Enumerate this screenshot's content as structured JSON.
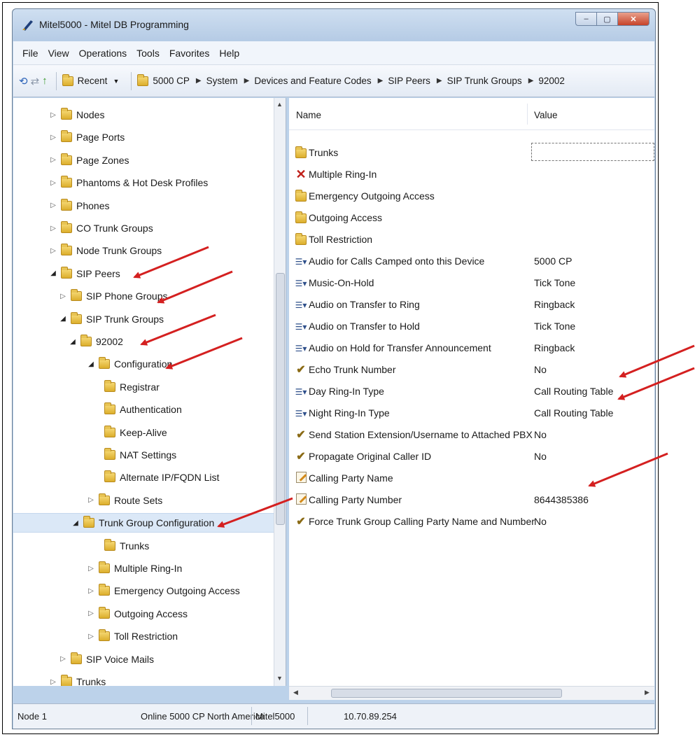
{
  "window": {
    "title": "Mitel5000 - Mitel DB Programming",
    "controls": {
      "minimize": "–",
      "maximize": "▢",
      "close": "✕"
    }
  },
  "menubar": [
    "File",
    "View",
    "Operations",
    "Tools",
    "Favorites",
    "Help"
  ],
  "navbar": {
    "recent_label": "Recent",
    "breadcrumbs": [
      "5000 CP",
      "System",
      "Devices and Feature Codes",
      "SIP Peers",
      "SIP Trunk Groups",
      "92002"
    ]
  },
  "tree": {
    "items": [
      {
        "label": "Nodes",
        "state": "collapsed"
      },
      {
        "label": "Page Ports",
        "state": "collapsed"
      },
      {
        "label": "Page Zones",
        "state": "collapsed"
      },
      {
        "label": "Phantoms & Hot Desk Profiles",
        "state": "collapsed"
      },
      {
        "label": "Phones",
        "state": "collapsed"
      },
      {
        "label": "CO Trunk Groups",
        "state": "collapsed"
      },
      {
        "label": "Node Trunk Groups",
        "state": "collapsed"
      },
      {
        "label": "SIP Peers",
        "state": "expanded"
      },
      {
        "label": "SIP Phone Groups",
        "state": "collapsed"
      },
      {
        "label": "SIP Trunk Groups",
        "state": "expanded"
      },
      {
        "label": "92002",
        "state": "expanded"
      },
      {
        "label": "Configuration",
        "state": "expanded"
      },
      {
        "label": "Registrar",
        "state": "leaf"
      },
      {
        "label": "Authentication",
        "state": "leaf"
      },
      {
        "label": "Keep-Alive",
        "state": "leaf"
      },
      {
        "label": "NAT Settings",
        "state": "leaf"
      },
      {
        "label": "Alternate IP/FQDN List",
        "state": "leaf"
      },
      {
        "label": "Route Sets",
        "state": "collapsed"
      },
      {
        "label": "Trunk Group Configuration",
        "state": "expanded",
        "selected": true
      },
      {
        "label": "Trunks",
        "state": "leaf"
      },
      {
        "label": "Multiple Ring-In",
        "state": "collapsed"
      },
      {
        "label": "Emergency Outgoing Access",
        "state": "collapsed"
      },
      {
        "label": "Outgoing Access",
        "state": "collapsed"
      },
      {
        "label": "Toll Restriction",
        "state": "collapsed"
      },
      {
        "label": "SIP Voice Mails",
        "state": "collapsed"
      },
      {
        "label": "Trunks",
        "state": "collapsed"
      }
    ]
  },
  "list": {
    "header": {
      "name": "Name",
      "value": "Value"
    },
    "rows": [
      {
        "icon": "folder-icon",
        "name": "Trunks",
        "value": ""
      },
      {
        "icon": "x-icon",
        "name": "Multiple Ring-In",
        "value": ""
      },
      {
        "icon": "folder-icon",
        "name": "Emergency Outgoing Access",
        "value": ""
      },
      {
        "icon": "folder-icon",
        "name": "Outgoing Access",
        "value": ""
      },
      {
        "icon": "folder-icon",
        "name": "Toll Restriction",
        "value": ""
      },
      {
        "icon": "list-icon",
        "name": "Audio for Calls Camped onto this Device",
        "value": "5000 CP"
      },
      {
        "icon": "list-icon",
        "name": "Music-On-Hold",
        "value": "Tick Tone"
      },
      {
        "icon": "list-icon",
        "name": "Audio on Transfer to Ring",
        "value": "Ringback"
      },
      {
        "icon": "list-icon",
        "name": "Audio on Transfer to Hold",
        "value": "Tick Tone"
      },
      {
        "icon": "list-icon",
        "name": "Audio on Hold for Transfer Announcement",
        "value": "Ringback"
      },
      {
        "icon": "check-icon",
        "name": "Echo Trunk Number",
        "value": "No"
      },
      {
        "icon": "list-icon",
        "name": "Day Ring-In Type",
        "value": "Call Routing Table"
      },
      {
        "icon": "list-icon",
        "name": "Night Ring-In Type",
        "value": "Call Routing Table"
      },
      {
        "icon": "check-icon",
        "name": "Send Station Extension/Username to Attached PBX",
        "value": "No"
      },
      {
        "icon": "check-icon",
        "name": "Propagate Original Caller ID",
        "value": "No"
      },
      {
        "icon": "edit-icon",
        "name": "Calling Party Name",
        "value": ""
      },
      {
        "icon": "edit-icon",
        "name": "Calling Party Number",
        "value": "8644385386"
      },
      {
        "icon": "check-icon",
        "name": "Force Trunk Group Calling Party Name and Number",
        "value": "No"
      }
    ]
  },
  "statusbar": {
    "node": "Node 1",
    "state": "Online 5000 CP North America",
    "system": "Mitel5000",
    "ip": "10.70.89.254"
  },
  "colors": {
    "annotation_arrow": "#d42020",
    "selection": "#dbe8f7",
    "folder": "#e8c454"
  }
}
